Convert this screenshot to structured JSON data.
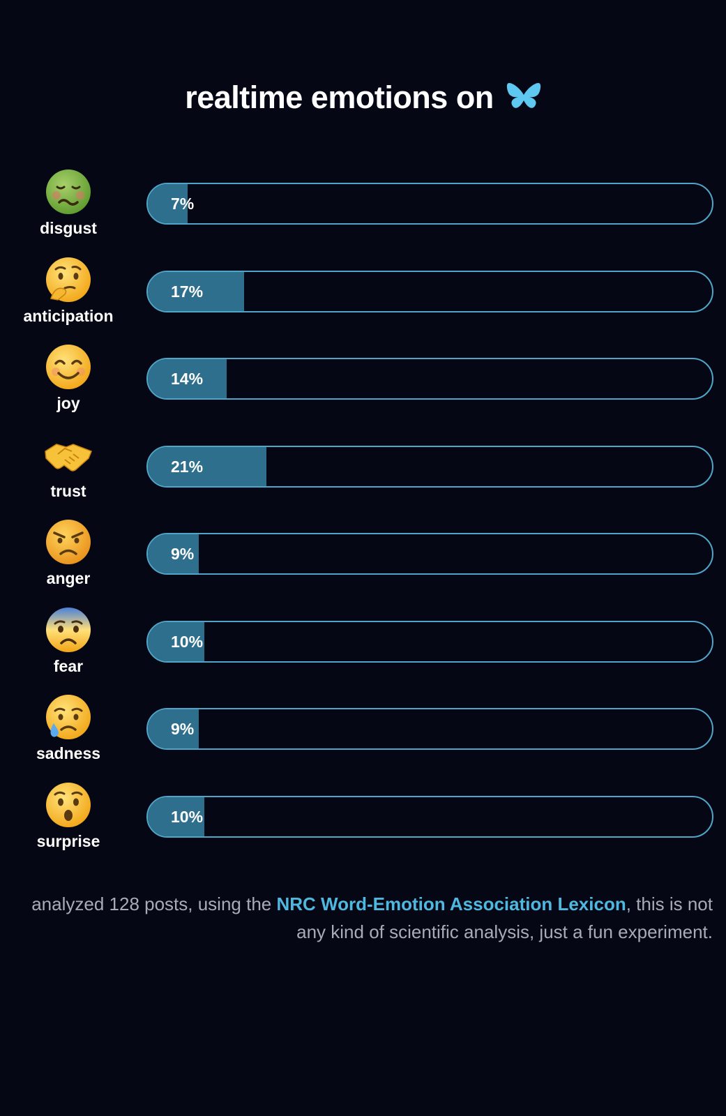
{
  "header": {
    "title": "realtime emotions on",
    "logo_icon": "bluesky-butterfly-icon",
    "logo_color": "#5ec8f0"
  },
  "colors": {
    "background": "#050814",
    "bar_fill": "#2f6f8e",
    "bar_border": "#4fa6c9",
    "link": "#4fb8e0",
    "footer_text": "#a9acb8"
  },
  "chart_data": {
    "type": "bar",
    "orientation": "horizontal",
    "unit": "%",
    "xlim": [
      0,
      100
    ],
    "categories": [
      "disgust",
      "anticipation",
      "joy",
      "trust",
      "anger",
      "fear",
      "sadness",
      "surprise"
    ],
    "values": [
      7,
      17,
      14,
      21,
      9,
      10,
      9,
      10
    ],
    "value_labels": [
      "7%",
      "17%",
      "14%",
      "21%",
      "9%",
      "10%",
      "9%",
      "10%"
    ],
    "icons": [
      "nauseated-face-icon",
      "thinking-face-icon",
      "smiling-face-icon",
      "handshake-icon",
      "angry-face-icon",
      "fearful-face-icon",
      "crying-face-icon",
      "astonished-face-icon"
    ]
  },
  "footer": {
    "text_before": "analyzed 128 posts, using the ",
    "link_text": "NRC Word-Emotion Association Lexicon",
    "text_after": ", this is not any kind of scientific analysis, just a fun experiment."
  }
}
